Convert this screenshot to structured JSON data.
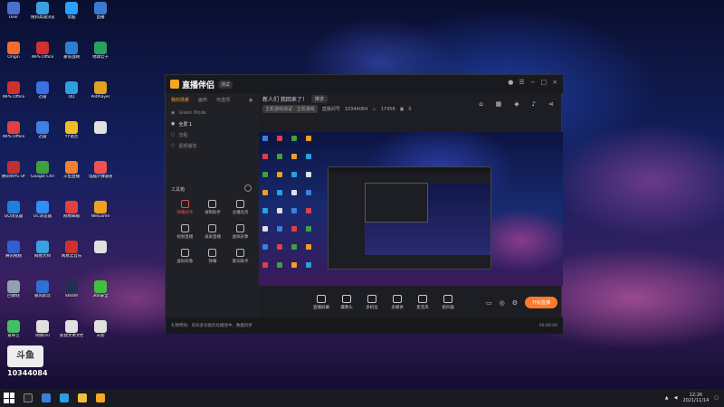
{
  "desktop": {
    "icons": [
      {
        "label": "User",
        "c": "#4a6fd0"
      },
      {
        "label": "搜狗高速浏览器",
        "c": "#3ba0e0"
      },
      {
        "label": "优酷",
        "c": "#2aa0ff"
      },
      {
        "label": "直播",
        "c": "#3a7ad0"
      },
      {
        "label": "Origin",
        "c": "#f56c2d"
      },
      {
        "label": "WPS Office",
        "c": "#d03030"
      },
      {
        "label": "暴雪战网",
        "c": "#2a80d0"
      },
      {
        "label": "地球云子",
        "c": "#2aa060"
      },
      {
        "label": "WPS Office",
        "c": "#d03030"
      },
      {
        "label": "迅雷",
        "c": "#3a70e0"
      },
      {
        "label": "QQ",
        "c": "#2aa0e0"
      },
      {
        "label": "PotPlayer",
        "c": "#e0a020"
      },
      {
        "label": "WPS Office",
        "c": "#e04040"
      },
      {
        "label": "迅雷",
        "c": "#4080e0"
      },
      {
        "label": "YY语音",
        "c": "#f0c020"
      },
      {
        "label": "",
        "c": "#e0e0e0"
      },
      {
        "label": "腾讯WPS Office",
        "c": "#c03030"
      },
      {
        "label": "Google Chrome",
        "c": "#40a040"
      },
      {
        "label": "斗鱼直播",
        "c": "#f08030"
      },
      {
        "label": "电脑计算器管家",
        "c": "#f05050"
      },
      {
        "label": "QQ浏览器",
        "c": "#2080e0"
      },
      {
        "label": "UC浏览器",
        "c": "#3090f0"
      },
      {
        "label": "网易邮箱",
        "c": "#e04040"
      },
      {
        "label": "WeGame",
        "c": "#f0a020"
      },
      {
        "label": "腾讯视频",
        "c": "#3060d0"
      },
      {
        "label": "网易大师",
        "c": "#3aa0e0"
      },
      {
        "label": "网易云音乐",
        "c": "#d03030"
      },
      {
        "label": "",
        "c": "#e0e0e0"
      },
      {
        "label": "回收站",
        "c": "#90a0b0"
      },
      {
        "label": "暴风影音",
        "c": "#3070d0"
      },
      {
        "label": "Steam",
        "c": "#203050"
      },
      {
        "label": "360安全",
        "c": "#40c040"
      },
      {
        "label": "爱奇艺",
        "c": "#40c060"
      },
      {
        "label": "网易UU",
        "c": "#e0e0e0"
      },
      {
        "label": "新建文本文档",
        "c": "#e0e0e0"
      },
      {
        "label": "天使",
        "c": "#e0e0e0"
      }
    ]
  },
  "app": {
    "brand": "直播伴侣",
    "version": "测试",
    "tabs": [
      "我的场景",
      "画布",
      "可选项"
    ],
    "scenes": [
      "Green Mode",
      "全屏 1",
      "流程",
      "视频播放"
    ],
    "tools_header": "工具箱",
    "tools": [
      "弹幕助手",
      "录制助手",
      "主播任务",
      "视频直播",
      "录屏直播",
      "虚拟形象",
      "虚拟形象",
      "弹幕",
      "歌词助手"
    ],
    "room": {
      "title": "新人们 我回来了！",
      "tag": "推流",
      "category": "主机游戏测试 · 主机游戏",
      "room_label": "直播间号",
      "room_id": "10344084",
      "hot": "17458",
      "count": "0"
    },
    "bottom": [
      "直播屏幕",
      "摄像头",
      "多机位",
      "多媒体",
      "麦克风",
      "扬声器"
    ],
    "live_button": "开始直播",
    "status": {
      "text": "礼物特效、房间多功能优化播放中、数据同步",
      "time": "00:00:00"
    }
  },
  "watermark": {
    "room_id": "10344084"
  },
  "taskbar": {
    "time": "12:26",
    "date": "2021/11/14"
  }
}
